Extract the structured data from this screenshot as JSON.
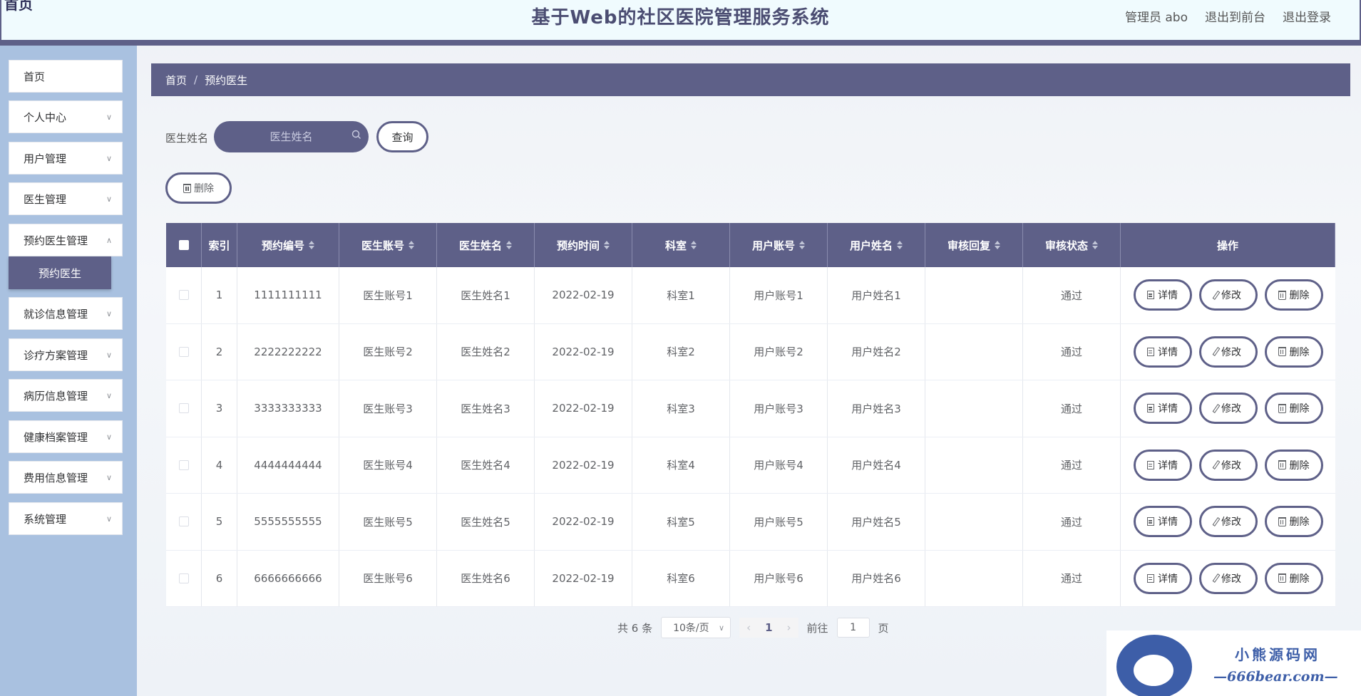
{
  "header": {
    "logo": "首页",
    "title": "基于Web的社区医院管理服务系统",
    "user": "管理员 abo",
    "front_link": "退出到前台",
    "logout": "退出登录"
  },
  "sidebar": {
    "items": [
      {
        "label": "首页"
      },
      {
        "label": "个人中心"
      },
      {
        "label": "用户管理"
      },
      {
        "label": "医生管理"
      },
      {
        "label": "预约医生管理"
      },
      {
        "label": "就诊信息管理"
      },
      {
        "label": "诊疗方案管理"
      },
      {
        "label": "病历信息管理"
      },
      {
        "label": "健康档案管理"
      },
      {
        "label": "费用信息管理"
      },
      {
        "label": "系统管理"
      }
    ],
    "active_sub": "预约医生"
  },
  "breadcrumb": {
    "home": "首页",
    "separator": "/",
    "current": "预约医生"
  },
  "search": {
    "label": "医生姓名",
    "placeholder": "医生姓名",
    "button": "查询"
  },
  "toolbar": {
    "delete": "删除"
  },
  "table": {
    "headers": [
      "索引",
      "预约编号",
      "医生账号",
      "医生姓名",
      "预约时间",
      "科室",
      "用户账号",
      "用户姓名",
      "审核回复",
      "审核状态",
      "操作"
    ],
    "actions": {
      "detail": "详情",
      "edit": "修改",
      "delete": "删除"
    },
    "rows": [
      [
        "1",
        "1111111111",
        "医生账号1",
        "医生姓名1",
        "2022-02-19",
        "科室1",
        "用户账号1",
        "用户姓名1",
        "",
        "通过"
      ],
      [
        "2",
        "2222222222",
        "医生账号2",
        "医生姓名2",
        "2022-02-19",
        "科室2",
        "用户账号2",
        "用户姓名2",
        "",
        "通过"
      ],
      [
        "3",
        "3333333333",
        "医生账号3",
        "医生姓名3",
        "2022-02-19",
        "科室3",
        "用户账号3",
        "用户姓名3",
        "",
        "通过"
      ],
      [
        "4",
        "4444444444",
        "医生账号4",
        "医生姓名4",
        "2022-02-19",
        "科室4",
        "用户账号4",
        "用户姓名4",
        "",
        "通过"
      ],
      [
        "5",
        "5555555555",
        "医生账号5",
        "医生姓名5",
        "2022-02-19",
        "科室5",
        "用户账号5",
        "用户姓名5",
        "",
        "通过"
      ],
      [
        "6",
        "6666666666",
        "医生账号6",
        "医生姓名6",
        "2022-02-19",
        "科室6",
        "用户账号6",
        "用户姓名6",
        "",
        "通过"
      ]
    ]
  },
  "pagination": {
    "total": "共 6 条",
    "page_size": "10条/页",
    "current": "1",
    "goto_label": "前往",
    "goto_value": "1",
    "page_suffix": "页"
  },
  "watermark": {
    "line1": "小熊源码网",
    "line2": "—666bear.com—"
  }
}
